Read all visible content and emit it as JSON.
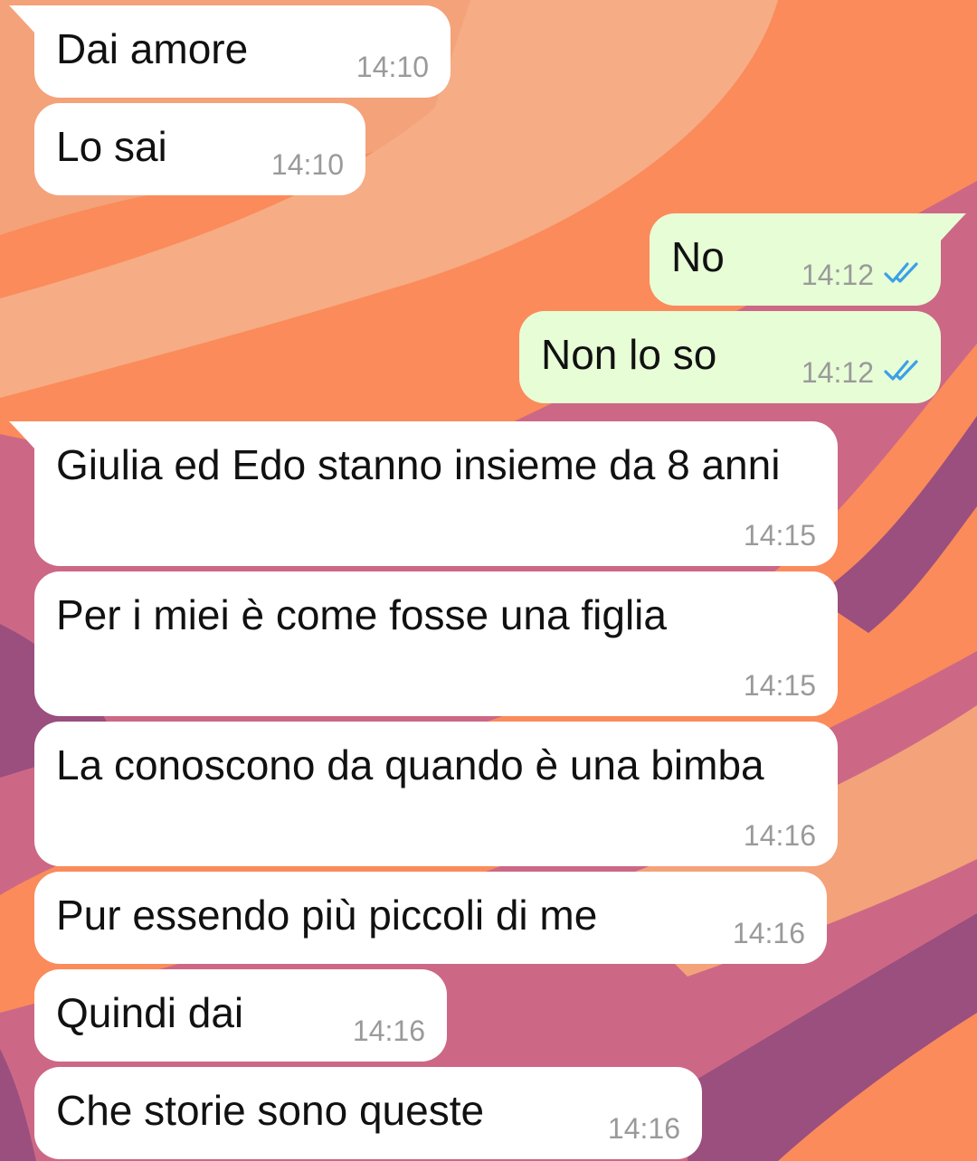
{
  "colors": {
    "incoming_bubble": "#ffffff",
    "outgoing_bubble": "#e7fdd6",
    "message_text": "#111111",
    "timestamp": "#9a9a9a",
    "read_ticks": "#3aa0e8",
    "wallpaper": [
      "#f4a27a",
      "#fb8b5b",
      "#cc6886",
      "#9a4f7e"
    ]
  },
  "messages": [
    {
      "direction": "incoming",
      "text": "Dai amore",
      "time": "14:10"
    },
    {
      "direction": "incoming",
      "text": "Lo sai",
      "time": "14:10"
    },
    {
      "direction": "outgoing",
      "text": "No",
      "time": "14:12",
      "status": "read-double-check-icon"
    },
    {
      "direction": "outgoing",
      "text": "Non lo so",
      "time": "14:12",
      "status": "read-double-check-icon"
    },
    {
      "direction": "incoming",
      "text": "Giulia ed Edo stanno insieme da 8 anni",
      "time": "14:15"
    },
    {
      "direction": "incoming",
      "text": "Per i miei è come fosse una figlia",
      "time": "14:15"
    },
    {
      "direction": "incoming",
      "text": "La conoscono da quando è una bimba",
      "time": "14:16"
    },
    {
      "direction": "incoming",
      "text": "Pur essendo più piccoli di me",
      "time": "14:16"
    },
    {
      "direction": "incoming",
      "text": "Quindi dai",
      "time": "14:16"
    },
    {
      "direction": "incoming",
      "text": "Che storie sono queste",
      "time": "14:16"
    }
  ]
}
